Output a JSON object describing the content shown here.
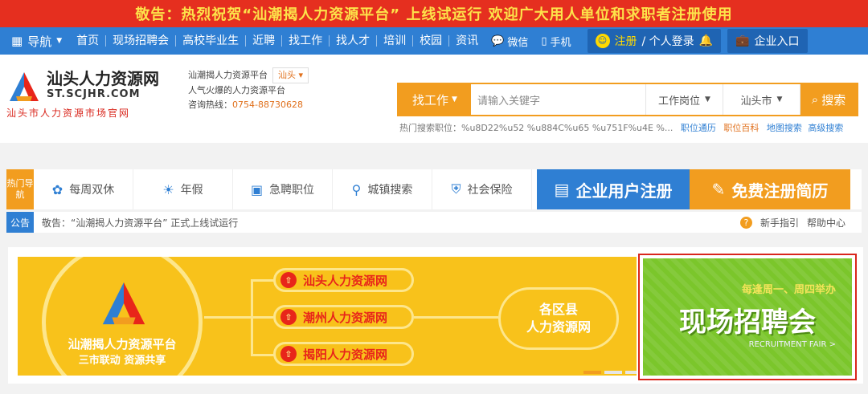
{
  "banner": {
    "text": "敬告：热烈祝贺“汕潮揭人力资源平台” 上线试运行   欢迎广大用人单位和求职者注册使用"
  },
  "nav": {
    "menu_label": "导航",
    "links": [
      "首页",
      "现场招聘会",
      "高校毕业生",
      "近聘",
      "找工作",
      "找人才",
      "培训",
      "校园",
      "资讯"
    ],
    "wechat": "微信",
    "mobile": "手机",
    "register": "注册",
    "login": "/ 个人登录",
    "enterprise": "企业入口"
  },
  "header": {
    "logo_title": "汕头人力资源网",
    "logo_domain": "ST.SCJHR.COM",
    "logo_subtitle": "汕头市人力资源市场官网",
    "platform": "汕潮揭人力资源平台",
    "city": "汕头",
    "tagline": "人气火爆的人力资源平台",
    "hotline_label": "咨询热线：",
    "hotline": "0754-88730628"
  },
  "search": {
    "tab_label": "找工作",
    "placeholder": "请输入关键字",
    "type_select": "工作岗位",
    "city_select": "汕头市",
    "button": "搜索",
    "hot_label": "热门搜索职位：",
    "hot_text": "%u8D22%u52 %u884C%u65 %u751F%u4E %...",
    "links": [
      "职位通历",
      "职位百科",
      "地图搜索",
      "高级搜索"
    ]
  },
  "quick": {
    "hot_nav": "热门导航",
    "items": [
      {
        "icon": "bag-icon",
        "label": "每周双休"
      },
      {
        "icon": "palm-icon",
        "label": "年假"
      },
      {
        "icon": "briefcase-icon",
        "label": "急聘职位"
      },
      {
        "icon": "location-icon",
        "label": "城镇搜索"
      },
      {
        "icon": "shield-icon",
        "label": "社会保险"
      }
    ],
    "company_register": "企业用户注册",
    "resume_register": "免费注册简历"
  },
  "notice": {
    "label": "公告",
    "text": "敬告：“汕潮揭人力资源平台” 正式上线试运行",
    "guide": "新手指引",
    "help": "帮助中心"
  },
  "promo": {
    "circle_title": "汕潮揭人力资源平台",
    "circle_sub": "三市联动 资源共享",
    "sites": [
      "汕头人力资源网",
      "潮州人力资源网",
      "揭阳人力资源网"
    ],
    "oval_line1": "各区县",
    "oval_line2": "人力资源网",
    "fair_sub": "每逢周一、周四举办",
    "fair_title": "现场招聘会",
    "fair_en": "RECRUITMENT FAIR >"
  }
}
